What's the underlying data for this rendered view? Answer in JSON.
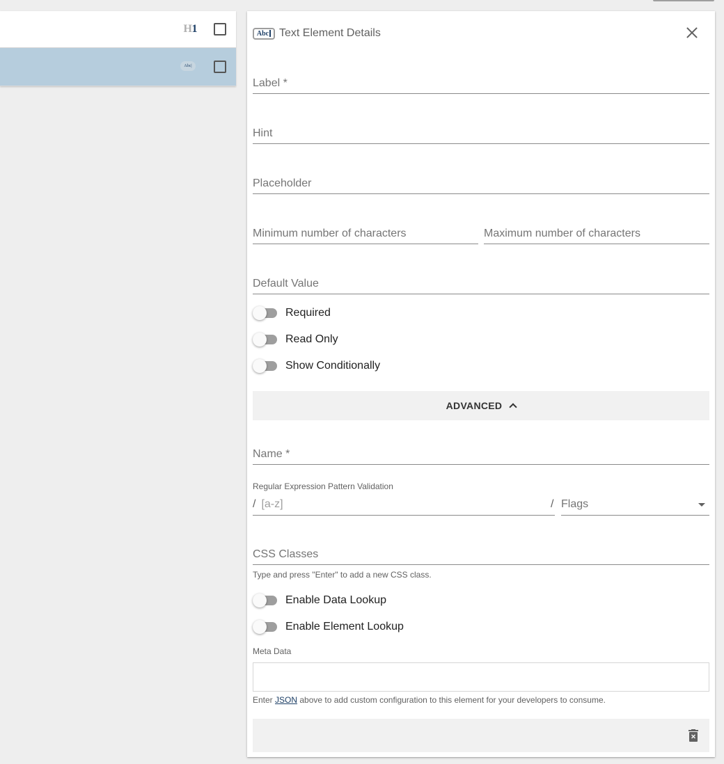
{
  "list": {
    "rows": [
      {
        "icon": "heading-h1-icon",
        "icon_text_h": "H",
        "icon_text_1": "1",
        "selected": false
      },
      {
        "icon": "text-field-icon",
        "icon_text": "Abc|",
        "selected": true
      }
    ]
  },
  "panel": {
    "header_icon_text": "Abc",
    "title": "Text Element Details",
    "fields": {
      "label_placeholder": "Label *",
      "hint_placeholder": "Hint",
      "placeholder_placeholder": "Placeholder",
      "min_chars_placeholder": "Minimum number of characters",
      "max_chars_placeholder": "Maximum number of characters",
      "default_value_placeholder": "Default Value"
    },
    "toggles": {
      "required": "Required",
      "read_only": "Read Only",
      "show_conditionally": "Show Conditionally"
    },
    "advanced": {
      "label": "ADVANCED",
      "name_placeholder": "Name *",
      "regex_label": "Regular Expression Pattern Validation",
      "regex_prefix": "/",
      "regex_placeholder": "[a-z]",
      "regex_separator": "/",
      "flags_label": "Flags",
      "css_placeholder": "CSS Classes",
      "css_helper": "Type and press \"Enter\" to add a new CSS class.",
      "enable_data_lookup": "Enable Data Lookup",
      "enable_element_lookup": "Enable Element Lookup",
      "meta_label": "Meta Data",
      "meta_helper_before": "Enter ",
      "meta_helper_link": "JSON",
      "meta_helper_after": " above to add custom configuration to this element for your developers to consume."
    }
  },
  "colors": {
    "selected_row": "#b6cddd",
    "accent": "#1d3f66",
    "toggle_track": "#9e9e9e"
  }
}
